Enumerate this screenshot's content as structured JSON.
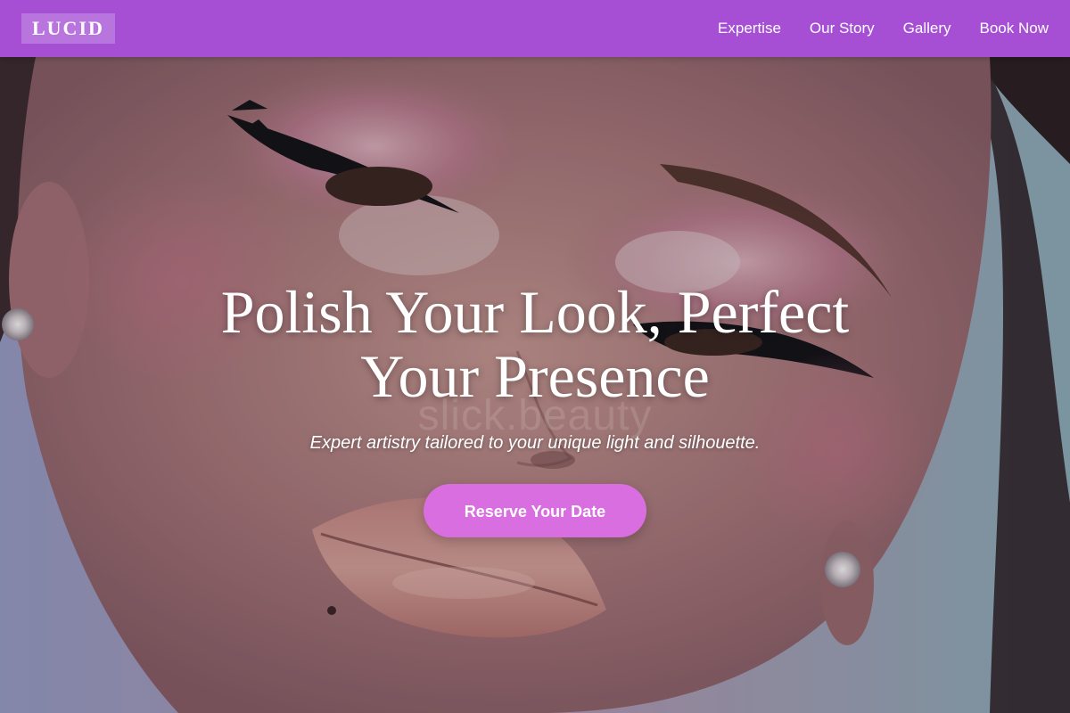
{
  "brand": {
    "logo_text": "LUCID",
    "header_color": "#a64fd5"
  },
  "nav": {
    "items": [
      {
        "label": "Expertise"
      },
      {
        "label": "Our Story"
      },
      {
        "label": "Gallery"
      },
      {
        "label": "Book Now"
      }
    ]
  },
  "hero": {
    "title": "Polish Your Look, Perfect Your Presence",
    "subtitle": "Expert artistry tailored to your unique light and silhouette.",
    "cta_label": "Reserve Your Date",
    "cta_color": "#d86ee0",
    "watermark": "slick.beauty",
    "image_icon": "makeup-portrait-photo"
  }
}
